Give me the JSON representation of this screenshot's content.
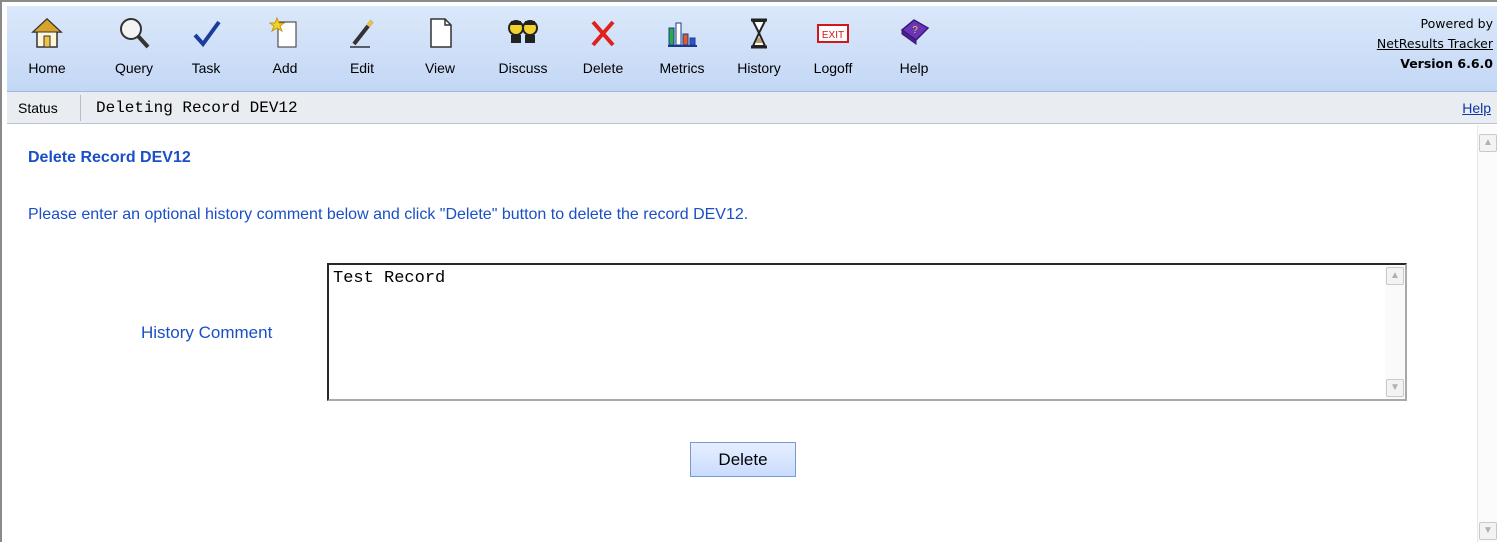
{
  "toolbar": {
    "buttons": [
      {
        "label": "Home",
        "icon": "home-icon"
      },
      {
        "label": "Query",
        "icon": "magnifier-icon"
      },
      {
        "label": "Task",
        "icon": "checkmark-icon"
      },
      {
        "label": "Add",
        "icon": "new-document-icon"
      },
      {
        "label": "Edit",
        "icon": "pencil-icon"
      },
      {
        "label": "View",
        "icon": "document-icon"
      },
      {
        "label": "Discuss",
        "icon": "people-icon"
      },
      {
        "label": "Delete",
        "icon": "red-x-icon"
      },
      {
        "label": "Metrics",
        "icon": "bar-chart-icon"
      },
      {
        "label": "History",
        "icon": "hourglass-icon"
      },
      {
        "label": "Logoff",
        "icon": "exit-sign-icon"
      },
      {
        "label": "Help",
        "icon": "help-book-icon"
      }
    ],
    "exit_text": "EXIT",
    "powered_by": "Powered by",
    "product_link": "NetResults Tracker",
    "version": "Version 6.6.0"
  },
  "status": {
    "label": "Status",
    "text": "Deleting Record DEV12",
    "help": "Help"
  },
  "main": {
    "title": "Delete Record DEV12",
    "instruction": "Please enter an optional history comment below and click \"Delete\" button to delete the record DEV12.",
    "comment_label": "History Comment",
    "comment_value": "Test Record",
    "delete_button": "Delete"
  },
  "colors": {
    "accent_text": "#1a4fc6",
    "toolbar_bg": "#c3d7f5",
    "delete_red": "#e0201b"
  }
}
